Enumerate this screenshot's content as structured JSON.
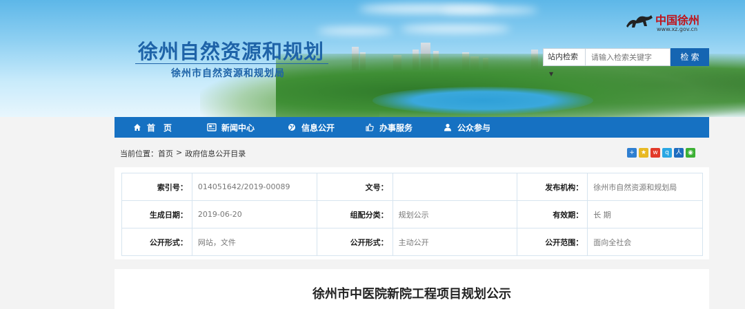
{
  "header": {
    "site_title": "徐州自然资源和规划",
    "site_subtitle": "徐州市自然资源和规划局",
    "logo_text": "中国徐州",
    "logo_url": "www.xz.gov.cn"
  },
  "search": {
    "scope_label": "站内检索",
    "placeholder": "请输入检索关键字",
    "button_label": "检 索"
  },
  "nav": {
    "items": [
      {
        "label": "首　页",
        "icon": "home-icon"
      },
      {
        "label": "新闻中心",
        "icon": "newspaper-icon"
      },
      {
        "label": "信息公开",
        "icon": "globe-icon"
      },
      {
        "label": "办事服务",
        "icon": "thumbs-up-icon"
      },
      {
        "label": "公众参与",
        "icon": "user-icon"
      }
    ]
  },
  "breadcrumb": {
    "prefix": "当前位置：",
    "home": "首页",
    "separator": ">",
    "current": "政府信息公开目录"
  },
  "share_icons": [
    "plus-share-icon",
    "qzone-icon",
    "weibo-icon",
    "qq-icon",
    "renren-icon",
    "wechat-icon"
  ],
  "info": {
    "rows": [
      [
        {
          "key": "索引号：",
          "value": "014051642/2019-00089"
        },
        {
          "key": "文号：",
          "value": ""
        },
        {
          "key": "发布机构：",
          "value": "徐州市自然资源和规划局"
        }
      ],
      [
        {
          "key": "生成日期：",
          "value": "2019-06-20"
        },
        {
          "key": "组配分类：",
          "value": "规划公示"
        },
        {
          "key": "有效期：",
          "value": "长 期"
        }
      ],
      [
        {
          "key": "公开形式：",
          "value": "网站，文件"
        },
        {
          "key": "公开形式：",
          "value": "主动公开"
        },
        {
          "key": "公开范围：",
          "value": "面向全社会"
        }
      ]
    ]
  },
  "article": {
    "title": "徐州市中医院新院工程项目规划公示"
  },
  "colors": {
    "nav_bg": "#1671c2",
    "title_blue": "#1e63a8",
    "search_button": "#1565b2",
    "logo_red": "#c0131a"
  }
}
